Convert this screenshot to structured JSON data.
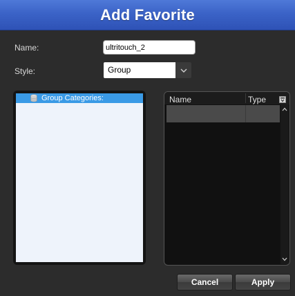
{
  "dialog": {
    "title": "Add Favorite"
  },
  "form": {
    "name_label": "Name:",
    "name_value": "ultritouch_2",
    "style_label": "Style:",
    "style_value": "Group"
  },
  "tree": {
    "root_label": "Group Categories:",
    "root_icon": "database-icon"
  },
  "list": {
    "columns": [
      "Name",
      "Type"
    ],
    "corner_icon": "column-chooser-icon"
  },
  "buttons": {
    "cancel_label": "Cancel",
    "apply_label": "Apply"
  },
  "colors": {
    "title_bar": "#3b63c7",
    "selection": "#3a9ae6",
    "background": "#2c2c2c"
  }
}
